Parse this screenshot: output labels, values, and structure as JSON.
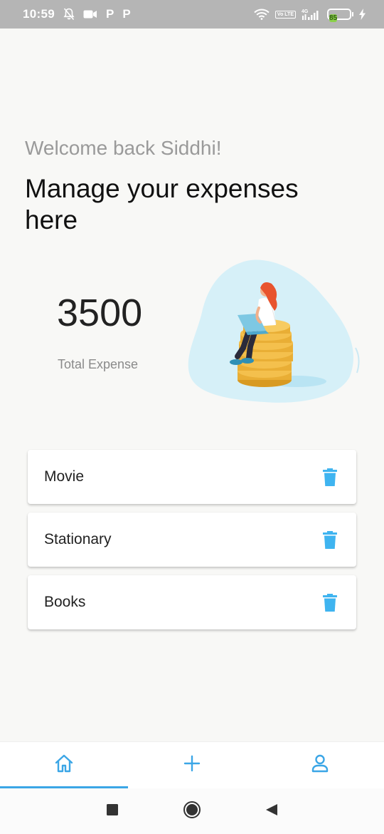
{
  "status_bar": {
    "time": "10:59",
    "left_icons": [
      "bell-off-icon",
      "video-icon",
      "p-icon",
      "p-icon"
    ],
    "p_label": "P",
    "volte_label": "Vo LTE",
    "network_label": "4G",
    "battery_level": "85",
    "battery_color": "#8bd14a"
  },
  "header": {
    "welcome": "Welcome back Siddhi!",
    "headline": "Manage your expenses here"
  },
  "summary": {
    "total_value": "3500",
    "total_label": "Total Expense"
  },
  "expenses": [
    {
      "name": "Movie"
    },
    {
      "name": "Stationary"
    },
    {
      "name": "Books"
    }
  ],
  "bottom_nav": {
    "items": [
      "home-icon",
      "plus-icon",
      "person-icon"
    ],
    "active": "home"
  },
  "colors": {
    "accent": "#3ba6e6",
    "delete_icon": "#3fb4f0",
    "background": "#f8f8f6"
  }
}
